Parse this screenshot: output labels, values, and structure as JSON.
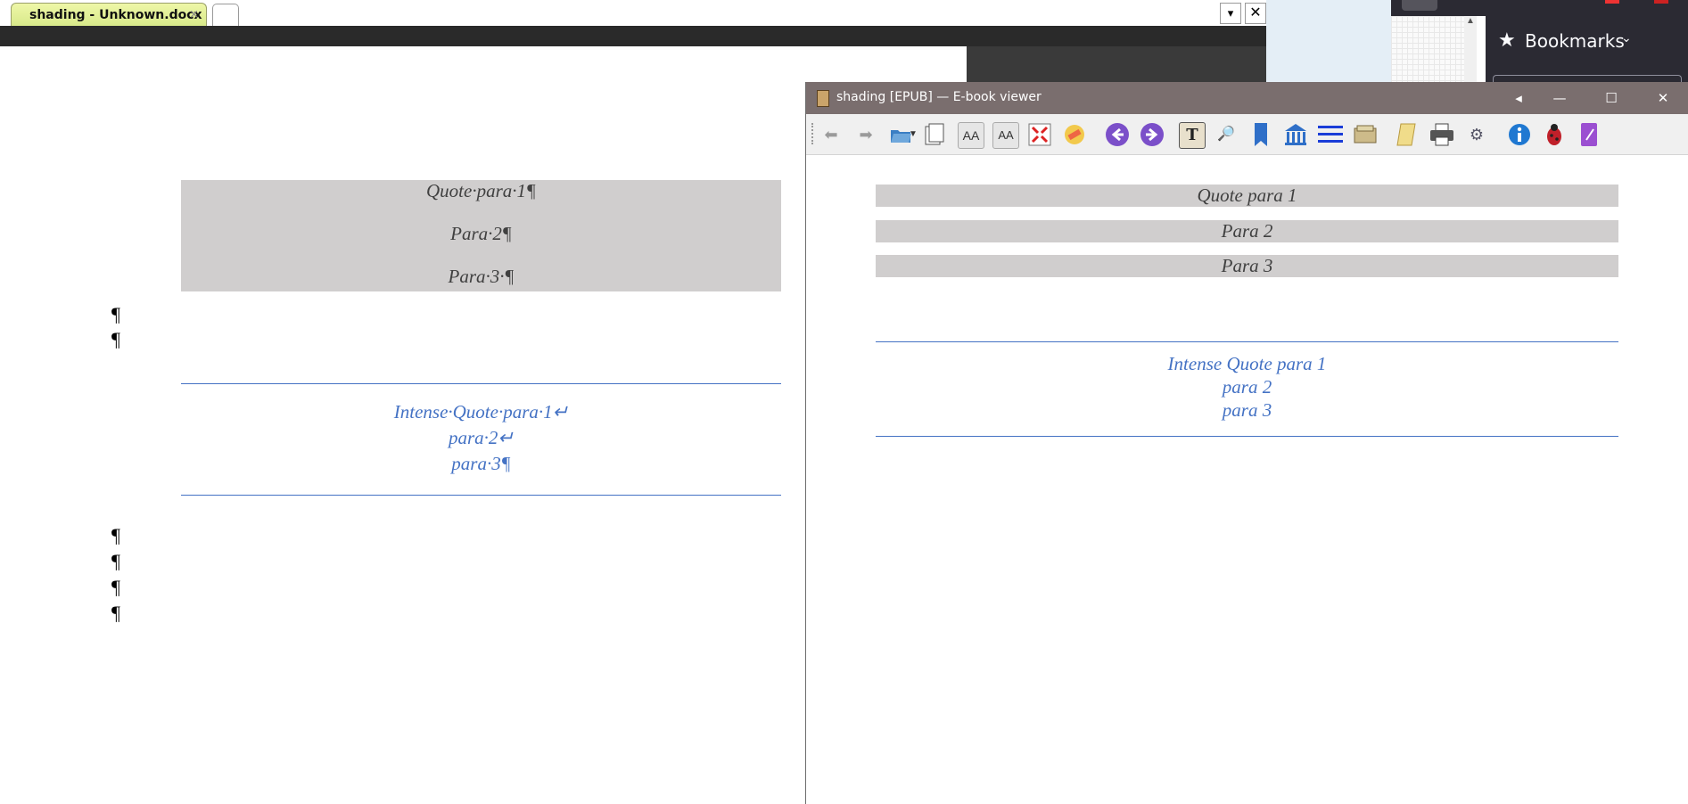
{
  "word_processor": {
    "tab_title": "shading - Unknown.docx",
    "tab_close": "×",
    "quote_paras": [
      "Quote·para·1¶",
      "Para·2¶",
      "Para·3·¶"
    ],
    "pilcrow": "¶",
    "intense_paras": [
      "Intense·Quote·para·1↵",
      "para·2↵",
      "para·3¶"
    ],
    "dropdown_button": "▾",
    "close_button": "✕"
  },
  "browser": {
    "bookmarks_label": "Bookmarks",
    "bookmarks_chevron": "⌄",
    "star_icon": "★"
  },
  "ebook_viewer": {
    "title": "shading [EPUB] — E-book viewer",
    "title_buttons": {
      "back": "◂",
      "minimize": "—",
      "maximize": "☐",
      "close": "✕"
    },
    "toolbar_icons": [
      "back-arrow-icon",
      "forward-arrow-icon",
      "open-folder-icon",
      "dropdown-icon",
      "copy-page-icon",
      "font-larger-icon",
      "font-smaller-icon",
      "fullscreen-icon",
      "preferences-icon",
      "previous-icon",
      "next-icon",
      "text-icon",
      "look-up-icon",
      "bookmark-icon",
      "library-icon",
      "toc-icon",
      "reference-icon",
      "scroll-icon",
      "print-icon",
      "debug-icon",
      "info-icon",
      "bug-icon",
      "theme-icon"
    ],
    "quote_paras": [
      "Quote para 1",
      "Para 2",
      "Para 3"
    ],
    "intense_paras": [
      "Intense Quote para 1",
      "para 2",
      "para 3"
    ]
  },
  "colors": {
    "quote_shading": "#d0cece",
    "intense_blue": "#4472c4",
    "viewer_titlebar": "#7a6e6e",
    "tab_yellow": "#d8e98a"
  }
}
